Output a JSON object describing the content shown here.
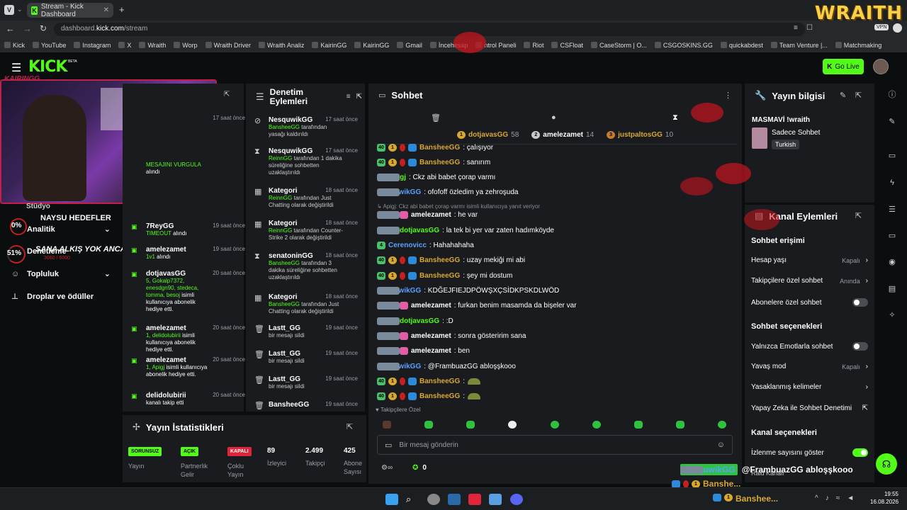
{
  "browser": {
    "tab_title": "Stream - Kick Dashboard",
    "url_prefix": "dashboard.",
    "url_domain": "kick.com",
    "url_path": "/stream",
    "vpn": "VPN",
    "bookmarks": [
      "Kick",
      "YouTube",
      "Instagram",
      "X",
      "Wraith",
      "Worp",
      "Wraith Driver",
      "Wraith Analiz",
      "KairinGG",
      "KairinGG",
      "Gmail",
      "İncehesap",
      "ntrol Paneli",
      "Riot",
      "CSFloat",
      "CaseStorm | O...",
      "CSGOSKINS.GG",
      "quickabdest",
      "Team Venture |...",
      "Matchmaking"
    ]
  },
  "overlay": {
    "brand": "WRAITH",
    "streamer_logo": "KAIRINGG",
    "goal1_percent": "0%",
    "goal1_text": "NAYSU HEDEFLER",
    "goal2_percent": "51%",
    "goal2_text": "SANA ALKIŞ YOK ANCA KICK",
    "goal2_sub": "3060 / 6000"
  },
  "header": {
    "logo": "KICK",
    "beta": "BETA",
    "go_live": "Go Live"
  },
  "left_nav": {
    "items": [
      {
        "label": "Stüdyo",
        "dropdown": false
      },
      {
        "label": "Analitik",
        "dropdown": true
      },
      {
        "label": "Denetleme",
        "dropdown": false
      },
      {
        "label": "Topluluk",
        "dropdown": true
      },
      {
        "label": "Droplar ve ödüller",
        "dropdown": false
      }
    ]
  },
  "activity": [
    {
      "name": "",
      "time": "17 saat önce",
      "desc": "",
      "rest": ""
    },
    {
      "name": "",
      "time": "",
      "desc": "",
      "rest": ""
    },
    {
      "name": "",
      "time": "",
      "desc": "MESAJINI VURGULA",
      "rest": "alındı"
    },
    {
      "name": "7ReyGG",
      "time": "19 saat önce",
      "desc": "TIMEOUT",
      "rest": "alındı"
    },
    {
      "name": "amelezamet",
      "time": "19 saat önce",
      "desc": "1v1",
      "rest": "alındı"
    },
    {
      "name": "dotjavasGG",
      "time": "20 saat önce",
      "desc": "5, Gokalp7372, enesdgn90, stedeca, tomma, besoj",
      "rest": "isimli kullanıcıya abonelik hediye etti."
    },
    {
      "name": "amelezamet",
      "time": "20 saat önce",
      "desc": "1, delidolubirii",
      "rest": "isimli kullanıcıya abonelik hediye etti."
    },
    {
      "name": "amelezamet",
      "time": "20 saat önce",
      "desc": "1, Apigj",
      "rest": "isimli kullanıcıya abonelik hediye etti."
    },
    {
      "name": "delidolubirii",
      "time": "20 saat önce",
      "desc": "",
      "rest": "kanalı takip etti"
    }
  ],
  "moderation": {
    "title": "Denetim Eylemleri",
    "items": [
      {
        "icon": "ban-icon",
        "name": "NesquwikGG",
        "time": "17 saat önce",
        "actor": "BansheeGG",
        "text": "tarafından yasağı kaldırıldı"
      },
      {
        "icon": "hourglass-icon",
        "name": "NesquwikGG",
        "time": "17 saat önce",
        "actor": "ReinnGG",
        "text": "tarafından 1 dakika süreliğine sohbetten uzaklaştırıldı"
      },
      {
        "icon": "calendar-icon",
        "name": "Kategori",
        "time": "18 saat önce",
        "actor": "ReinnGG",
        "text": "tarafından Just Chatting olarak değiştirildi"
      },
      {
        "icon": "calendar-icon",
        "name": "Kategori",
        "time": "18 saat önce",
        "actor": "ReinnGG",
        "text": "tarafından Counter-Strike 2 olarak değiştirildi"
      },
      {
        "icon": "hourglass-icon",
        "name": "senatoninGG",
        "time": "18 saat önce",
        "actor": "BansheeGG",
        "text": "tarafından 3 dakika süreliğine sohbetten uzaklaştırıldı"
      },
      {
        "icon": "calendar-icon",
        "name": "Kategori",
        "time": "18 saat önce",
        "actor": "BansheeGG",
        "text": "tarafından Just Chatting olarak değiştirildi"
      },
      {
        "icon": "trash-icon",
        "name": "Lastt_GG",
        "time": "19 saat önce",
        "actor": "",
        "text": "bir mesajı sildi"
      },
      {
        "icon": "trash-icon",
        "name": "Lastt_GG",
        "time": "19 saat önce",
        "actor": "",
        "text": "bir mesajı sildi"
      },
      {
        "icon": "trash-icon",
        "name": "Lastt_GG",
        "time": "19 saat önce",
        "actor": "",
        "text": "bir mesajı sildi"
      },
      {
        "icon": "trash-icon",
        "name": "BansheeGG",
        "time": "19 saat önce",
        "actor": "",
        "text": ""
      }
    ]
  },
  "chat": {
    "title": "Sohbet",
    "leaderboard": [
      {
        "rank": "1",
        "name": "dotjavasGG",
        "count": "58"
      },
      {
        "rank": "2",
        "name": "amelezamet",
        "count": "14"
      },
      {
        "rank": "3",
        "name": "justpaltosGG",
        "count": "10"
      }
    ],
    "reply_hint": "Apigj: Ckz abi babet çorap varmı isimli kullanıcıya yanıt veriyor",
    "messages": [
      {
        "badges": [
          "sub40",
          "one",
          "red",
          "blue"
        ],
        "user": "BansheeGG",
        "color": "#d8a830",
        "text": ": çalışıyor"
      },
      {
        "badges": [
          "sub40",
          "one",
          "red",
          "blue"
        ],
        "user": "BansheeGG",
        "color": "#d8a830",
        "text": ": sanırım"
      },
      {
        "badges": [
          "sub37",
          "mod"
        ],
        "user": "Apigj",
        "color": "#53fc18",
        "text": ": Ckz abi babet çorap varmı"
      },
      {
        "badges": [
          "mod"
        ],
        "user": "NesquwikGG",
        "color": "#5aa0ff",
        "text": ": ofofoff özledim ya zehroşuda"
      },
      {
        "badges": [
          "crown",
          "one",
          "gift",
          "mod"
        ],
        "user": "amelezamet",
        "color": "#ffffff",
        "text": ": he var"
      },
      {
        "badges": [
          "crown",
          "one",
          "mod"
        ],
        "user": "dotjavasGG",
        "color": "#53fc18",
        "text": ": la tek bi yer var zaten hadımköyde"
      },
      {
        "badges": [
          "sub4"
        ],
        "user": "Cerenovicc",
        "color": "#5aa0ff",
        "text": ": Hahahahaha"
      },
      {
        "badges": [
          "sub40",
          "one",
          "red",
          "blue"
        ],
        "user": "BansheeGG",
        "color": "#d8a830",
        "text": ": uzay mekiği mi abi"
      },
      {
        "badges": [
          "sub40",
          "one",
          "red",
          "blue"
        ],
        "user": "BansheeGG",
        "color": "#d8a830",
        "text": ": şey mi dostum"
      },
      {
        "badges": [
          "mod"
        ],
        "user": "NesquwikGG",
        "color": "#5aa0ff",
        "text": ": KDĞEJFIEJDPÖWŞXÇSİDKPSKDLWÖD"
      },
      {
        "badges": [
          "crown",
          "one",
          "gift",
          "mod"
        ],
        "user": "amelezamet",
        "color": "#ffffff",
        "text": ": furkan benim masamda da bişeler var"
      },
      {
        "badges": [
          "crown",
          "one",
          "mod"
        ],
        "user": "dotjavasGG",
        "color": "#53fc18",
        "text": ": :D"
      },
      {
        "badges": [
          "crown",
          "one",
          "gift",
          "mod"
        ],
        "user": "amelezamet",
        "color": "#ffffff",
        "text": ": sonra gösteririm sana"
      },
      {
        "badges": [
          "crown",
          "one",
          "gift",
          "mod"
        ],
        "user": "amelezamet",
        "color": "#ffffff",
        "text": ": ben"
      },
      {
        "badges": [
          "mod"
        ],
        "user": "NesquwikGG",
        "color": "#5aa0ff",
        "text": ": @FrambuazGG abloşşkooo"
      },
      {
        "badges": [
          "sub40",
          "one",
          "red",
          "blue"
        ],
        "user": "BansheeGG",
        "color": "#d8a830",
        "text": ":"
      },
      {
        "badges": [
          "sub40",
          "one",
          "red",
          "blue"
        ],
        "user": "BansheeGG",
        "color": "#d8a830",
        "text": ":"
      }
    ],
    "followers_only": "Takipçilere Özel",
    "input_placeholder": "Bir mesaj gönderin",
    "points": "0"
  },
  "stream_info": {
    "title": "Yayın bilgisi",
    "stream_title": "MASMAVİ !wraith",
    "category": "Sadece Sohbet",
    "language": "Turkish"
  },
  "channel_actions": {
    "title": "Kanal Eylemleri",
    "chat_access": "Sohbet erişimi",
    "account_age": {
      "label": "Hesap yaşı",
      "value": "Kapalı"
    },
    "followers_chat": {
      "label": "Takipçilere özel sohbet",
      "value": "Anında"
    },
    "subs_chat": {
      "label": "Abonelere özel sohbet"
    },
    "chat_options": "Sohbet seçenekleri",
    "emote_only": {
      "label": "Yalnızca Emotlarla sohbet"
    },
    "slow_mode": {
      "label": "Yavaş mod",
      "value": "Kapalı"
    },
    "banned_words": {
      "label": "Yasaklanmış kelimeler"
    },
    "ai_moderation": {
      "label": "Yapay Zeka ile Sohbet Denetimi"
    },
    "channel_options": "Kanal seçenekleri",
    "view_count": {
      "label": "İzlenme sayısını göster"
    },
    "raid": "Raid Kanalı"
  },
  "stats": {
    "title": "Yayın İstatistikleri",
    "items": [
      {
        "tag": "SORUNSUZ",
        "label": "Yayın"
      },
      {
        "tag": "AÇIK",
        "label": "Partnerlik Gelir"
      },
      {
        "tag": "KAPALI",
        "label": "Çoklu Yayın"
      },
      {
        "value": "89",
        "label": "İzleyici"
      },
      {
        "value": "2.499",
        "label": "Takipçi"
      },
      {
        "value": "425",
        "label": "Abone Sayısı"
      }
    ]
  },
  "floating": {
    "mention": "@FrambuazGG abloşşkooo",
    "user_ghost": "NesquwikGG",
    "banshee": "Banshe...",
    "banshee2": "Banshee..."
  },
  "taskbar": {
    "time": "19:55",
    "date": "16.08.2026"
  },
  "colors": {
    "kick_green": "#53fc18",
    "panel": "#191b1f",
    "bg": "#0b0e0f"
  }
}
